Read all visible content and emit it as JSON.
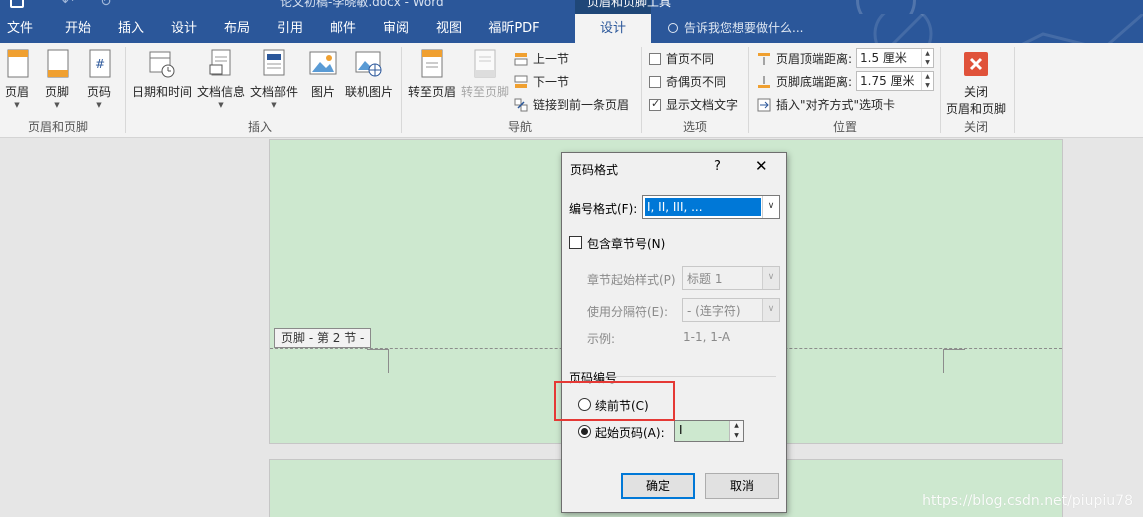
{
  "titlebar": {
    "title": "论文初稿-李晓敏.docx - Word",
    "context_tab": "页眉和页脚工具"
  },
  "tabs": [
    {
      "label": "文件",
      "active": false
    },
    {
      "label": "开始",
      "active": false
    },
    {
      "label": "插入",
      "active": false
    },
    {
      "label": "设计",
      "active": false
    },
    {
      "label": "布局",
      "active": false
    },
    {
      "label": "引用",
      "active": false
    },
    {
      "label": "邮件",
      "active": false
    },
    {
      "label": "审阅",
      "active": false
    },
    {
      "label": "视图",
      "active": false
    },
    {
      "label": "福昕PDF",
      "active": false
    },
    {
      "label": "设计",
      "active": true
    }
  ],
  "tell_me": "告诉我您想要做什么...",
  "ribbon": {
    "header_footer_group": {
      "label": "页眉和页脚",
      "header": "页眉",
      "footer": "页脚",
      "page_number": "页码"
    },
    "insert_group": {
      "label": "插入",
      "date_time": "日期和时间",
      "doc_info": "文档信息",
      "doc_parts": "文档部件",
      "picture": "图片",
      "online_picture": "联机图片"
    },
    "navigation_group": {
      "label": "导航",
      "go_to_header": "转至页眉",
      "go_to_footer": "转至页脚",
      "previous": "上一节",
      "next": "下一节",
      "link_to_previous": "链接到前一条页眉"
    },
    "options_group": {
      "label": "选项",
      "different_first_page": "首页不同",
      "different_odd_even": "奇偶页不同",
      "show_doc_text": "显示文档文字"
    },
    "position_group": {
      "label": "位置",
      "header_from_top": "页眉顶端距离:",
      "header_from_top_value": "1.5 厘米",
      "footer_from_bottom": "页脚底端距离:",
      "footer_from_bottom_value": "1.75 厘米",
      "insert_alignment_tab": "插入\"对齐方式\"选项卡"
    },
    "close_group": {
      "label": "关闭",
      "close_line1": "关闭",
      "close_line2": "页眉和页脚"
    }
  },
  "document": {
    "footer_tag": "页脚 - 第 2 节 -",
    "watermark": "https://blog.csdn.net/piupiu78"
  },
  "dialog": {
    "title": "页码格式",
    "help": "?",
    "close": "✕",
    "number_format_label": "编号格式(F):",
    "number_format_value": "I, II, III, ...",
    "include_chapter_label": "包含章节号(N)",
    "chapter_style_label": "章节起始样式(P)",
    "chapter_style_value": "标题 1",
    "separator_label": "使用分隔符(E):",
    "separator_value": "-  (连字符)",
    "example_label": "示例:",
    "example_value": "1-1, 1-A",
    "page_numbering_label": "页码编号",
    "continue_label": "续前节(C)",
    "start_at_label": "起始页码(A):",
    "start_at_value": "I",
    "ok": "确定",
    "cancel": "取消"
  }
}
